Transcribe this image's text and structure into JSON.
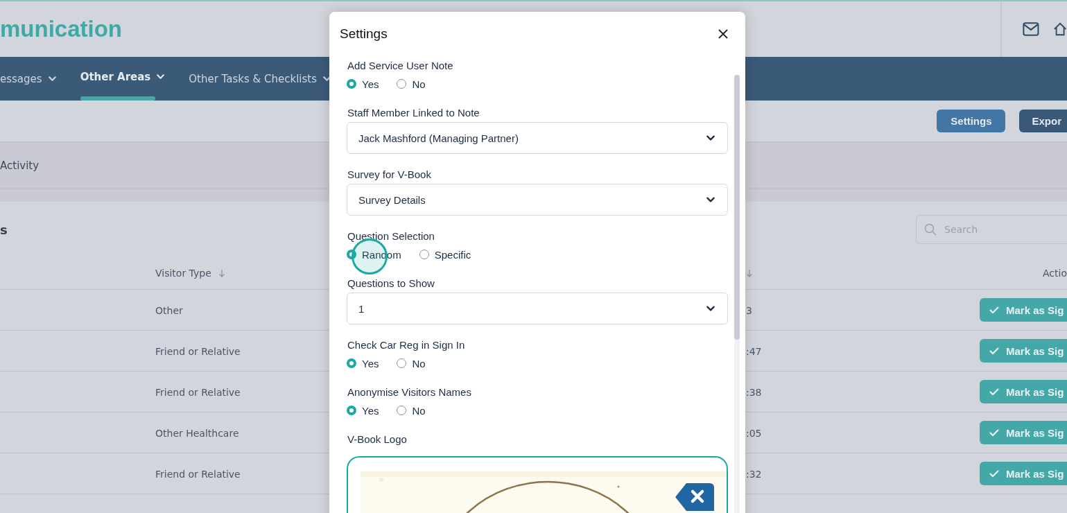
{
  "header": {
    "title": "munication"
  },
  "nav": {
    "items": [
      {
        "label": "essages",
        "selected": false
      },
      {
        "label": "Other Areas",
        "selected": true
      },
      {
        "label": "Other Tasks & Checklists",
        "selected": false
      }
    ]
  },
  "toolbar": {
    "buttons": [
      {
        "label": "Settings",
        "kind": "primary"
      },
      {
        "label": "Expor",
        "kind": "dark"
      }
    ]
  },
  "tabs": [
    {
      "label": "Activity"
    }
  ],
  "card": {
    "title": "s",
    "search": {
      "placeholder": "Search"
    }
  },
  "table": {
    "columns": [
      {
        "label": "Visitor Type",
        "sortable": true
      },
      {
        "sortable": true
      },
      {
        "label": "Actio",
        "sortable": false
      }
    ],
    "rows": [
      {
        "visitor_type": "Other",
        "time": "3",
        "action": "Mark as Sig"
      },
      {
        "visitor_type": "Friend or Relative",
        "time": ":47",
        "action": "Mark as Sig"
      },
      {
        "visitor_type": "Friend or Relative",
        "time": ":38",
        "action": "Mark as Sig"
      },
      {
        "visitor_type": "Other Healthcare",
        "time": ":05",
        "action": "Mark as Sig"
      },
      {
        "visitor_type": "Friend or Relative",
        "time": ":32",
        "action": "Mark as Sig"
      }
    ]
  },
  "modal": {
    "title": "Settings",
    "fields": [
      {
        "kind": "radio",
        "label": "Add Service User Note",
        "options": [
          {
            "label": "Yes",
            "selected": true
          },
          {
            "label": "No",
            "selected": false
          }
        ]
      },
      {
        "kind": "select",
        "label": "Staff Member Linked to Note",
        "value": "Jack Mashford (Managing Partner)"
      },
      {
        "kind": "select",
        "label": "Survey for V-Book",
        "value": "Survey Details"
      },
      {
        "kind": "radio",
        "label": "Question Selection",
        "options": [
          {
            "label": "Random",
            "selected": true
          },
          {
            "label": "Specific",
            "selected": false
          }
        ]
      },
      {
        "kind": "select",
        "label": "Questions to Show",
        "value": "1"
      },
      {
        "kind": "radio",
        "label": "Check Car Reg in Sign In",
        "options": [
          {
            "label": "Yes",
            "selected": true
          },
          {
            "label": "No",
            "selected": false
          }
        ]
      },
      {
        "kind": "radio",
        "label": "Anonymise Visitors Names",
        "options": [
          {
            "label": "Yes",
            "selected": true
          },
          {
            "label": "No",
            "selected": false
          }
        ]
      },
      {
        "label": "V-Book Logo"
      }
    ]
  }
}
